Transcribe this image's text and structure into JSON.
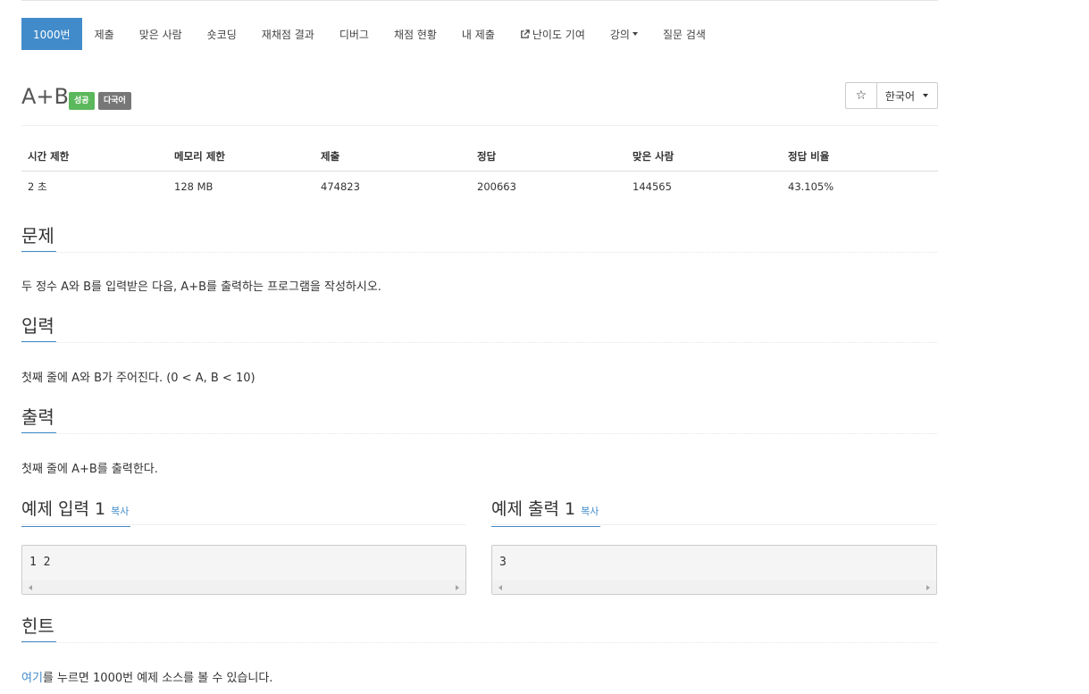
{
  "nav": {
    "tabs": [
      {
        "label": "1000번"
      },
      {
        "label": "제출"
      },
      {
        "label": "맞은 사람"
      },
      {
        "label": "숏코딩"
      },
      {
        "label": "재채점 결과"
      },
      {
        "label": "디버그"
      },
      {
        "label": "채점 현황"
      },
      {
        "label": "내 제출"
      },
      {
        "label": "난이도 기여"
      },
      {
        "label": "강의"
      },
      {
        "label": "질문 검색"
      }
    ]
  },
  "problem": {
    "title": "A+B",
    "badge_success": "성공",
    "badge_multilang": "다국어",
    "star": "☆",
    "language": "한국어"
  },
  "info_table": {
    "headers": [
      "시간 제한",
      "메모리 제한",
      "제출",
      "정답",
      "맞은 사람",
      "정답 비율"
    ],
    "values": [
      "2 초",
      "128 MB",
      "474823",
      "200663",
      "144565",
      "43.105%"
    ]
  },
  "sections": {
    "problem": {
      "title": "문제",
      "text": "두 정수 A와 B를 입력받은 다음, A+B를 출력하는 프로그램을 작성하시오."
    },
    "input": {
      "title": "입력",
      "text": "첫째 줄에 A와 B가 주어진다. (0 < A, B < 10)"
    },
    "output": {
      "title": "출력",
      "text": "첫째 줄에 A+B를 출력한다."
    },
    "hint": {
      "title": "힌트",
      "link": "여기",
      "text": "를 누르면 1000번 예제 소스를 볼 수 있습니다."
    }
  },
  "samples": {
    "input": {
      "title": "예제 입력 1",
      "copy": "복사",
      "content": "1 2"
    },
    "output": {
      "title": "예제 출력 1",
      "copy": "복사",
      "content": "3"
    }
  },
  "colors": {
    "accent": "#428bca",
    "success": "#5cb85c",
    "muted": "#777777"
  }
}
